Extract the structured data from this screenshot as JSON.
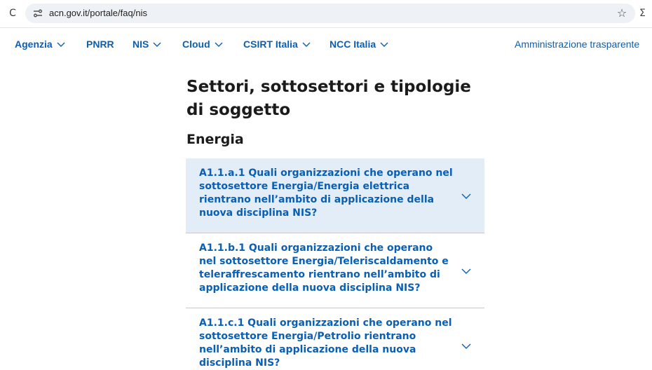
{
  "browser": {
    "url": "acn.gov.it/portale/faq/nis",
    "reload_glyph": "C",
    "star_glyph": "☆",
    "extension_glyph": "Σ"
  },
  "nav": {
    "items": [
      {
        "label": "Agenzia",
        "has_menu": true
      },
      {
        "label": "PNRR",
        "has_menu": false
      },
      {
        "label": "NIS",
        "has_menu": true
      },
      {
        "label": "Cloud",
        "has_menu": true
      },
      {
        "label": "CSIRT Italia",
        "has_menu": true
      },
      {
        "label": "NCC Italia",
        "has_menu": true
      }
    ],
    "admin_link": "Amministrazione trasparente"
  },
  "content": {
    "title": "Settori, sottosettori e tipologie di soggetto",
    "section": "Energia",
    "faqs": [
      {
        "question": "A1.1.a.1 Quali organizzazioni che operano nel sottosettore Energia/Energia elettrica rientrano nell’ambito di applicazione della nuova disciplina NIS?",
        "expanded": false,
        "highlighted": true
      },
      {
        "question": "A1.1.b.1 Quali organizzazioni che operano nel sottosettore Energia/Teleriscaldamento e teleraffrescamento rientrano nell’ambito di applicazione della nuova disciplina NIS?",
        "expanded": false,
        "highlighted": false
      },
      {
        "question": "A1.1.c.1 Quali organizzazioni che operano nel sottosettore Energia/Petrolio rientrano nell’ambito di applicazione della nuova disciplina NIS?",
        "expanded": false,
        "highlighted": false
      }
    ]
  },
  "colors": {
    "accent": "#0a5fb4",
    "highlight_bg": "#e2edf8",
    "omnibox_bg": "#eef1f5",
    "divider": "#c9c9c9"
  },
  "icons": {
    "reload": "reload-icon",
    "site_info": "site-info-icon",
    "bookmark": "bookmark-star-icon",
    "extension": "extension-icon",
    "chevron": "chevron-down-icon"
  }
}
